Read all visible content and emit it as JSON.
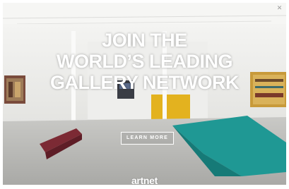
{
  "ad": {
    "headline_lines": [
      "JOIN THE",
      "WORLD’S LEADING",
      "GALLERY NETWORK"
    ],
    "cta_label": "LEARN MORE",
    "brand_logo": "artnet",
    "close_icon": "close-icon",
    "colors": {
      "text": "#ffffff",
      "wall": "#f2f2f0",
      "floor": "#b9b9b6",
      "teal_sculpture": "#1f9894",
      "yellow_panel": "#e3b21f",
      "maroon_bench": "#7c2a34"
    }
  }
}
